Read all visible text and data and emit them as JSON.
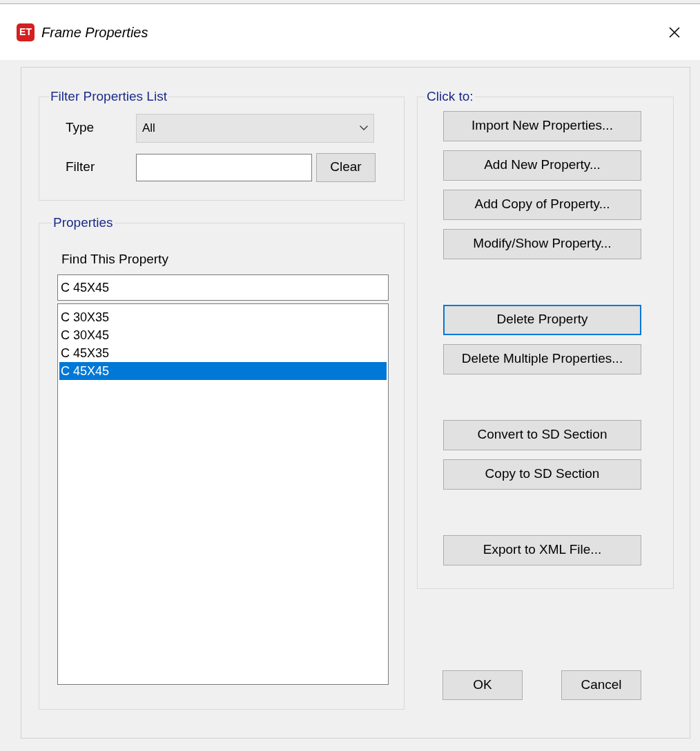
{
  "window": {
    "logo_text": "ET",
    "title": "Frame Properties"
  },
  "filter_group": {
    "title": "Filter Properties List",
    "type_label": "Type",
    "type_value": "All",
    "filter_label": "Filter",
    "clear_button": "Clear"
  },
  "properties_group": {
    "title": "Properties",
    "find_label": "Find This Property",
    "find_value": "C 45X45",
    "items": [
      {
        "label": "C 30X35",
        "selected": false
      },
      {
        "label": "C 30X45",
        "selected": false
      },
      {
        "label": "C 45X35",
        "selected": false
      },
      {
        "label": "C 45X45",
        "selected": true
      }
    ]
  },
  "actions_group": {
    "title": "Click to:",
    "button_groups": [
      [
        {
          "label": "Import New Properties...",
          "focused": false
        },
        {
          "label": "Add New Property...",
          "focused": false
        },
        {
          "label": "Add Copy of Property...",
          "focused": false
        },
        {
          "label": "Modify/Show Property...",
          "focused": false
        }
      ],
      [
        {
          "label": "Delete Property",
          "focused": true
        },
        {
          "label": "Delete Multiple Properties...",
          "focused": false
        }
      ],
      [
        {
          "label": "Convert to SD Section",
          "focused": false
        },
        {
          "label": "Copy to SD Section",
          "focused": false
        }
      ],
      [
        {
          "label": "Export to XML File...",
          "focused": false
        }
      ]
    ]
  },
  "footer_buttons": [
    "OK",
    "Cancel"
  ]
}
